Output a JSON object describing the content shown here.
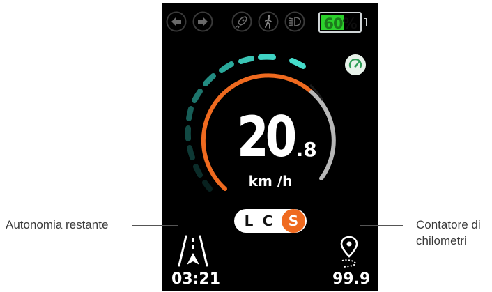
{
  "dashboard": {
    "battery": {
      "value": "60",
      "symbol": "%",
      "level": 0.6
    },
    "speed": {
      "integer": "20",
      "decimal": ".8",
      "unit": "km /h"
    },
    "modes": [
      {
        "label": "L",
        "active": false
      },
      {
        "label": "C",
        "active": false
      },
      {
        "label": "S",
        "active": true
      }
    ],
    "range_time": "03:21",
    "odometer": "99.9",
    "top_icons": [
      "arrow-left-icon",
      "arrow-right-icon",
      "rocket-icon",
      "walk-assist-icon",
      "headlight-icon"
    ],
    "colors": {
      "accent_orange": "#ef6a1f",
      "accent_teal": "#3fd3c4",
      "battery_green": "#2cd12c",
      "gauge_gray": "#b7b7b7"
    }
  },
  "callouts": {
    "left": "Autonomia restante",
    "right_line1": "Contatore di",
    "right_line2": "chilometri"
  }
}
